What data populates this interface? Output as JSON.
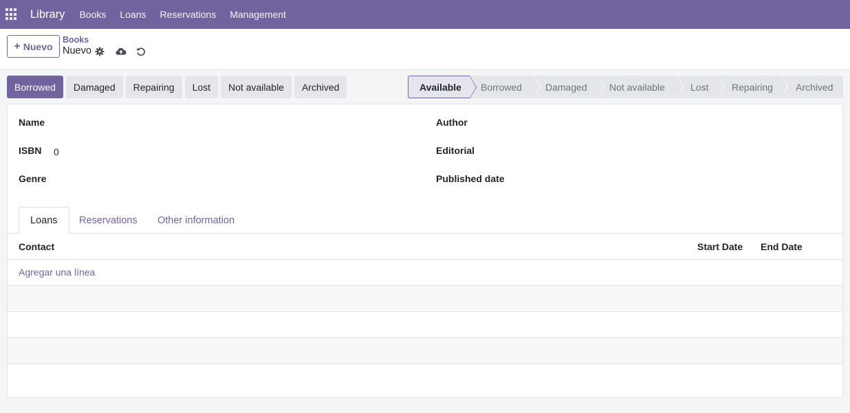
{
  "navbar": {
    "app_name": "Library",
    "menu": [
      "Books",
      "Loans",
      "Reservations",
      "Management"
    ]
  },
  "control_panel": {
    "new_button": "Nuevo",
    "breadcrumb_parent": "Books",
    "breadcrumb_current": "Nuevo",
    "icons": [
      "gear-icon",
      "cloud-upload-icon",
      "discard-icon"
    ]
  },
  "action_buttons": [
    "Borrowed",
    "Damaged",
    "Repairing",
    "Lost",
    "Not available",
    "Archived"
  ],
  "statusbar": {
    "stages": [
      "Available",
      "Borrowed",
      "Damaged",
      "Not available",
      "Lost",
      "Repairing",
      "Archived"
    ],
    "active": "Available"
  },
  "form": {
    "left_fields": [
      {
        "label": "Name",
        "value": ""
      },
      {
        "label": "ISBN",
        "value": "0"
      },
      {
        "label": "Genre",
        "value": ""
      }
    ],
    "right_fields": [
      {
        "label": "Author",
        "value": ""
      },
      {
        "label": "Editorial",
        "value": ""
      },
      {
        "label": "Published date",
        "value": ""
      }
    ]
  },
  "tabs": [
    "Loans",
    "Reservations",
    "Other information"
  ],
  "loans_table": {
    "columns": [
      "Contact",
      "Start Date",
      "End Date"
    ],
    "add_line": "Agregar una línea"
  },
  "colors": {
    "brand": "#71639e",
    "button_secondary": "#e4e6e9"
  }
}
